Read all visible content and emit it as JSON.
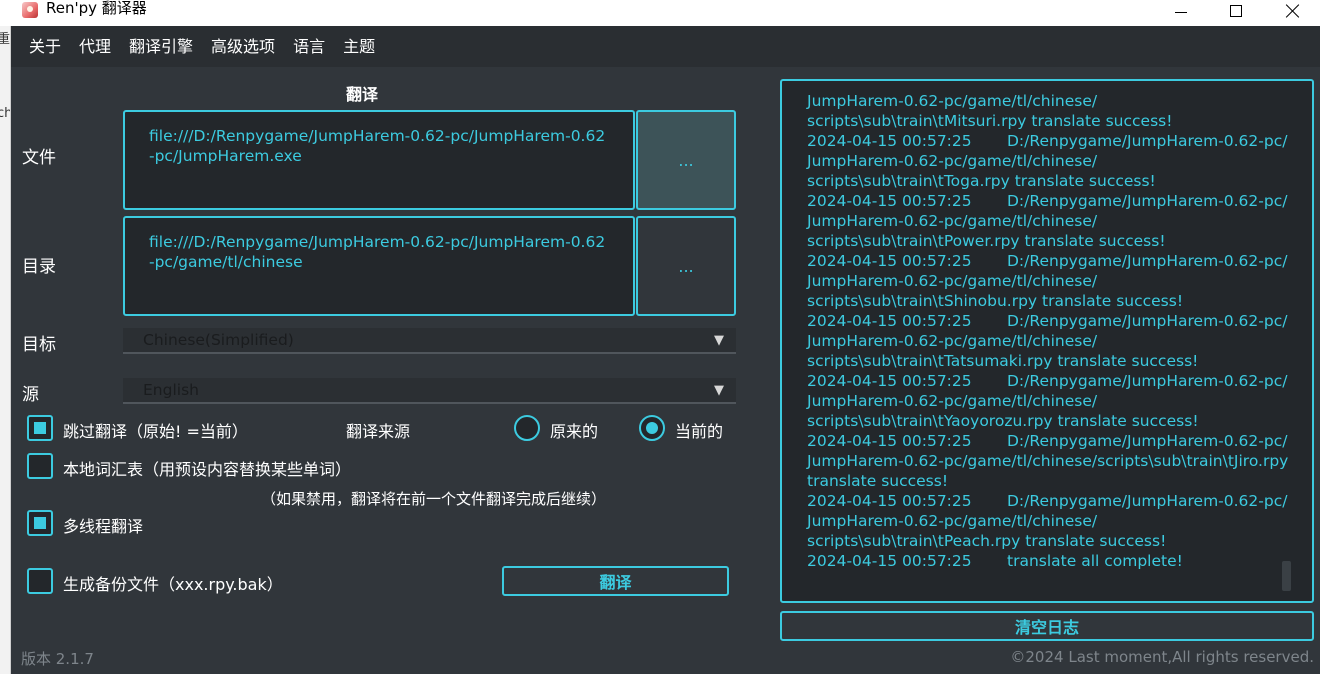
{
  "window": {
    "title": "Ren'py 翻译器"
  },
  "background_text": [
    "重",
    "ch"
  ],
  "menu": [
    "关于",
    "代理",
    "翻译引擎",
    "高级选项",
    "语言",
    "主题"
  ],
  "translate_section": {
    "title": "翻译",
    "file_label": "文件",
    "file_path": "file:///D:/Renpygame/JumpHarem-0.62-pc/JumpHarem-0.62-pc/JumpHarem.exe",
    "dir_label": "目录",
    "dir_path": "file:///D:/Renpygame/JumpHarem-0.62-pc/JumpHarem-0.62-pc/game/tl/chinese",
    "browse_label": "...",
    "target_label": "目标",
    "target_value": "Chinese(Simplified)",
    "source_label": "源",
    "source_value": "English"
  },
  "options": {
    "skip_translated": {
      "label": "跳过翻译（原始! =当前）",
      "checked": true
    },
    "translate_source_label": "翻译来源",
    "radio_original": {
      "label": "原来的",
      "checked": false
    },
    "radio_current": {
      "label": "当前的",
      "checked": true
    },
    "local_glossary": {
      "label": "本地词汇表（用预设内容替换某些单词）",
      "checked": false
    },
    "disabled_note": "（如果禁用，翻译将在前一个文件翻译完成后继续）",
    "multithread": {
      "label": "多线程翻译",
      "checked": true
    },
    "backup": {
      "label": "生成备份文件（xxx.rpy.bak）",
      "checked": false
    }
  },
  "translate_button": "翻译",
  "log": {
    "lines": [
      {
        "ts": "",
        "text": "JumpHarem-0.62-pc/game/tl/chinese/"
      },
      {
        "ts": "",
        "text": "scripts\\sub\\train\\tMitsuri.rpy translate success!"
      },
      {
        "ts": "2024-04-15 00:57:25",
        "text": "D:/Renpygame/JumpHarem-0.62-pc/"
      },
      {
        "ts": "",
        "text": "JumpHarem-0.62-pc/game/tl/chinese/"
      },
      {
        "ts": "",
        "text": "scripts\\sub\\train\\tToga.rpy translate success!"
      },
      {
        "ts": "2024-04-15 00:57:25",
        "text": "D:/Renpygame/JumpHarem-0.62-pc/"
      },
      {
        "ts": "",
        "text": "JumpHarem-0.62-pc/game/tl/chinese/"
      },
      {
        "ts": "",
        "text": "scripts\\sub\\train\\tPower.rpy translate success!"
      },
      {
        "ts": "2024-04-15 00:57:25",
        "text": "D:/Renpygame/JumpHarem-0.62-pc/"
      },
      {
        "ts": "",
        "text": "JumpHarem-0.62-pc/game/tl/chinese/"
      },
      {
        "ts": "",
        "text": "scripts\\sub\\train\\tShinobu.rpy translate success!"
      },
      {
        "ts": "2024-04-15 00:57:25",
        "text": "D:/Renpygame/JumpHarem-0.62-pc/"
      },
      {
        "ts": "",
        "text": "JumpHarem-0.62-pc/game/tl/chinese/"
      },
      {
        "ts": "",
        "text": "scripts\\sub\\train\\tTatsumaki.rpy translate success!"
      },
      {
        "ts": "2024-04-15 00:57:25",
        "text": "D:/Renpygame/JumpHarem-0.62-pc/"
      },
      {
        "ts": "",
        "text": "JumpHarem-0.62-pc/game/tl/chinese/"
      },
      {
        "ts": "",
        "text": "scripts\\sub\\train\\tYaoyorozu.rpy translate success!"
      },
      {
        "ts": "2024-04-15 00:57:25",
        "text": "D:/Renpygame/JumpHarem-0.62-pc/"
      },
      {
        "ts": "",
        "text": "JumpHarem-0.62-pc/game/tl/chinese/scripts\\sub\\train\\tJiro.rpy"
      },
      {
        "ts": "",
        "text": "translate success!"
      },
      {
        "ts": "2024-04-15 00:57:25",
        "text": "D:/Renpygame/JumpHarem-0.62-pc/"
      },
      {
        "ts": "",
        "text": "JumpHarem-0.62-pc/game/tl/chinese/"
      },
      {
        "ts": "",
        "text": "scripts\\sub\\train\\tPeach.rpy translate success!"
      },
      {
        "ts": "2024-04-15 00:57:25",
        "text": "translate all complete!"
      }
    ]
  },
  "clear_log_button": "清空日志",
  "footer": {
    "version": "版本 2.1.7",
    "copyright": "©2024 Last moment,All rights reserved."
  },
  "colors": {
    "accent": "#3ccbe0",
    "background": "#31363b",
    "field_background": "#23272b"
  }
}
